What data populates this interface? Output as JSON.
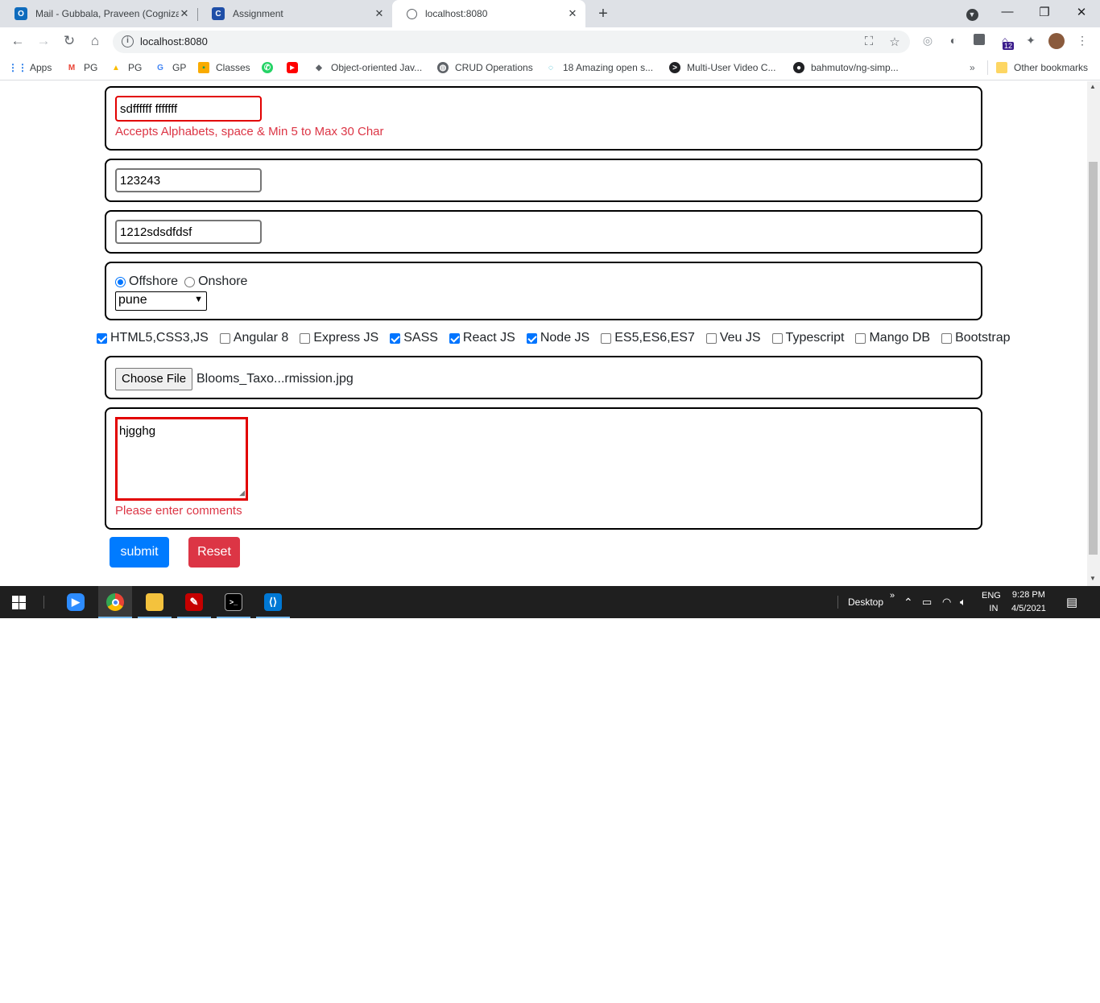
{
  "browser": {
    "tabs": [
      {
        "title": "Mail - Gubbala, Praveen (Cognizant)",
        "icon": "outlook-icon",
        "color": "#0f6cbd"
      },
      {
        "title": "Assignment",
        "icon": "coursera-icon",
        "color": "#1f4fa8"
      },
      {
        "title": "localhost:8080",
        "icon": "globe-icon",
        "color": "#5f6368"
      }
    ],
    "url": "localhost:8080",
    "extension_badge": "12",
    "bookmarks": [
      {
        "label": "Apps",
        "icon": "apps-grid-icon"
      },
      {
        "label": "PG",
        "icon": "gmail-icon"
      },
      {
        "label": "PG",
        "icon": "google-drive-icon"
      },
      {
        "label": "GP",
        "icon": "google-icon"
      },
      {
        "label": "Classes",
        "icon": "classroom-icon"
      },
      {
        "label": "",
        "icon": "whatsapp-icon"
      },
      {
        "label": "",
        "icon": "youtube-icon"
      },
      {
        "label": "Object-oriented Jav...",
        "icon": "bird-icon"
      },
      {
        "label": "CRUD Operations",
        "icon": "globe-icon"
      },
      {
        "label": "18 Amazing open s...",
        "icon": "spinner-icon"
      },
      {
        "label": "Multi-User Video C...",
        "icon": "terminal-icon"
      },
      {
        "label": "bahmutov/ng-simp...",
        "icon": "github-icon"
      }
    ],
    "other_bookmarks": "Other bookmarks"
  },
  "form": {
    "name_value": "sdffffff fffffff",
    "name_error": "Accepts Alphabets, space & Min 5 to Max 30 Char",
    "number_value": "123243",
    "code_value": "1212sdsdfdsf",
    "location_options": [
      {
        "label": "Offshore",
        "checked": true
      },
      {
        "label": "Onshore",
        "checked": false
      }
    ],
    "city_selected": "pune",
    "skills": [
      {
        "label": "HTML5,CSS3,JS",
        "checked": true
      },
      {
        "label": "Angular 8",
        "checked": false
      },
      {
        "label": "Express JS",
        "checked": false
      },
      {
        "label": "SASS",
        "checked": true
      },
      {
        "label": "React JS",
        "checked": true
      },
      {
        "label": "Node JS",
        "checked": true
      },
      {
        "label": "ES5,ES6,ES7",
        "checked": false
      },
      {
        "label": "Veu JS",
        "checked": false
      },
      {
        "label": "Typescript",
        "checked": false
      },
      {
        "label": "Mango DB",
        "checked": false
      },
      {
        "label": "Bootstrap",
        "checked": false
      }
    ],
    "file_button": "Choose File",
    "file_name": "Blooms_Taxo...rmission.jpg",
    "comments_value": "hjgghg",
    "comments_error": "Please enter comments",
    "submit_label": "submit",
    "reset_label": "Reset",
    "colors": {
      "submit": "#007bff",
      "reset": "#dc3545",
      "error": "#dc3545"
    }
  },
  "taskbar": {
    "apps": [
      "zoom-icon",
      "chrome-icon",
      "file-explorer-icon",
      "acrobat-icon",
      "terminal-icon",
      "vscode-icon"
    ],
    "desktop_label": "Desktop",
    "lang_top": "ENG",
    "lang_bottom": "IN",
    "time": "9:28 PM",
    "date": "4/5/2021"
  }
}
